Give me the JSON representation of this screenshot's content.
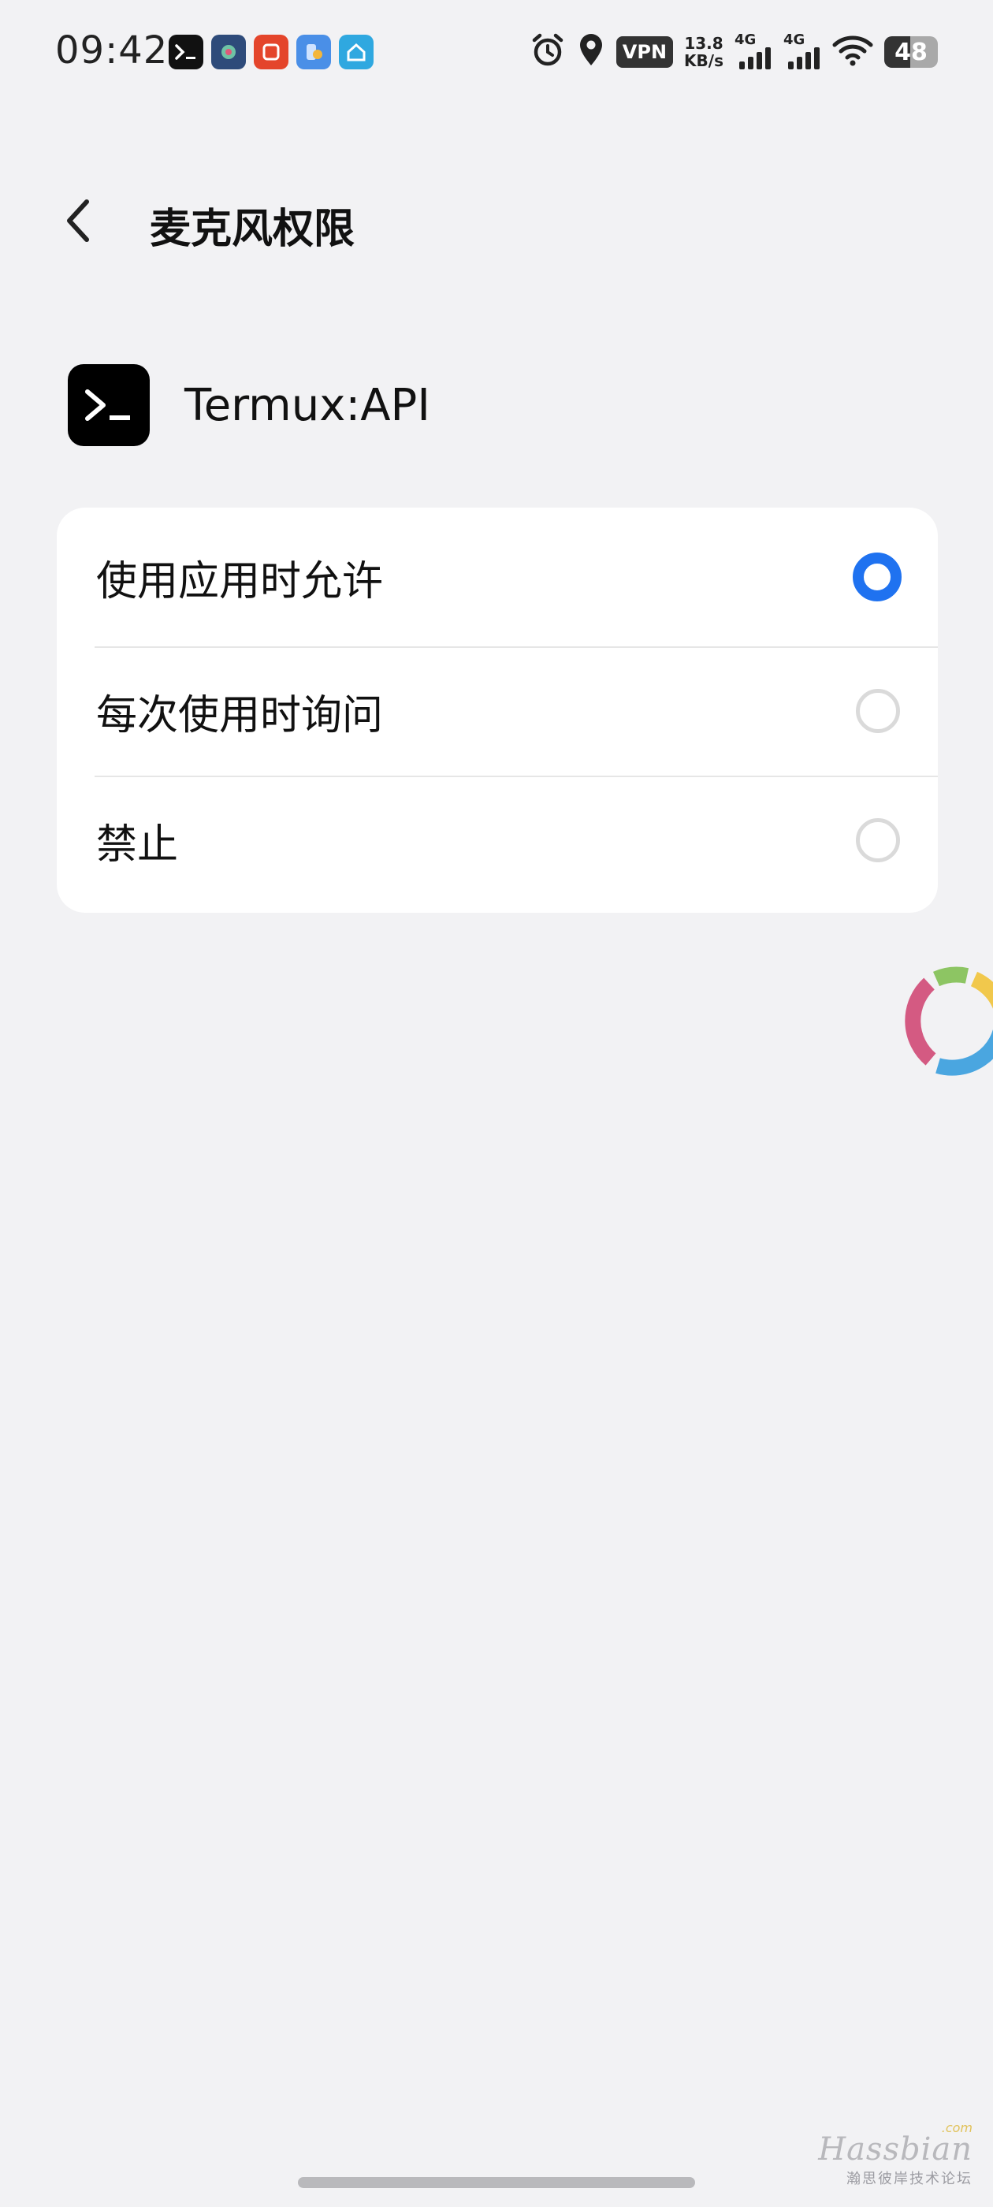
{
  "status_bar": {
    "time": "09:42",
    "vpn_label": "VPN",
    "speed_value": "13.8",
    "speed_unit": "KB/s",
    "signal1_label": "4G",
    "signal2_label": "4G",
    "battery_level": "48",
    "notification_icons": [
      "termux-icon",
      "app-icon",
      "listen-app-icon",
      "files-app-icon",
      "home-app-icon"
    ],
    "system_icons": [
      "alarm-icon",
      "location-icon",
      "vpn-icon",
      "signal-icon",
      "signal-icon",
      "wifi-icon",
      "battery-icon"
    ]
  },
  "header": {
    "title": "麦克风权限"
  },
  "app": {
    "name": "Termux:API"
  },
  "options": [
    {
      "label": "使用应用时允许",
      "selected": true
    },
    {
      "label": "每次使用时询问",
      "selected": false
    },
    {
      "label": "禁止",
      "selected": false
    }
  ],
  "watermark": {
    "brand": "Hassbian",
    "suffix": ".com",
    "subtitle": "瀚思彼岸技术论坛"
  },
  "colors": {
    "background": "#f2f2f4",
    "card": "#ffffff",
    "accent": "#1f72f0"
  }
}
